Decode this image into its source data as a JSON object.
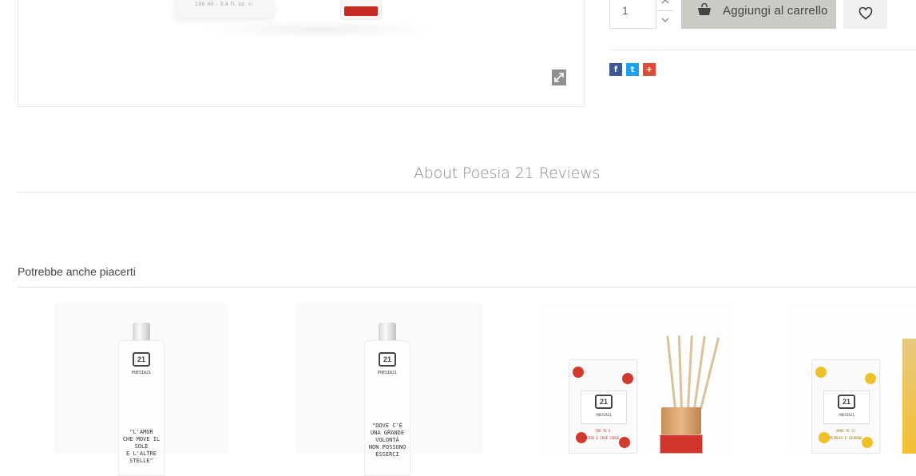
{
  "product": {
    "quantity_value": "1",
    "add_to_cart_label": "Aggiungi al carrello",
    "packaging_text": "100 ml - 3,4 fl. oz. ℮"
  },
  "social": {
    "facebook_glyph": "f",
    "twitter_glyph": "t",
    "googleplus_glyph": "+"
  },
  "tabs": [
    {
      "label": "About Poesia 21"
    },
    {
      "label": "Reviews"
    }
  ],
  "related": {
    "title": "Potrebbe anche piacerti",
    "items": [
      {
        "logo_text": "21",
        "brand_text": "POESIA21",
        "product_text": [
          "\"L'AMOR",
          "CHE MOVE IL SOLE",
          "E L'ALTRE STELLE\""
        ]
      },
      {
        "logo_text": "21",
        "brand_text": "POESIA21",
        "product_text": [
          "\"DOVE C'È",
          "UNA GRANDE VOLONTÀ",
          "NON POSSONO",
          "ESSERCI"
        ]
      },
      {
        "logo_text": "21",
        "brand_text": "POESIA21",
        "product_text": [
          "TRA TE E",
          "COSE E COSE CORSE"
        ]
      },
      {
        "logo_text": "21",
        "brand_text": "POESIA21",
        "product_text": [
          "AMOR TE 21",
          "PETROSA E CEDRONA"
        ]
      }
    ]
  },
  "colors": {
    "cart_button_bg": "#cbcbc6",
    "facebook": "#3b5998",
    "twitter": "#1da1f2",
    "googleplus": "#dd4b39"
  },
  "icons": {
    "expand": "expand-icon",
    "cart": "shopping-bag-icon",
    "wishlist": "heart-icon",
    "qty_up": "chevron-up-icon",
    "qty_down": "chevron-down-icon"
  }
}
